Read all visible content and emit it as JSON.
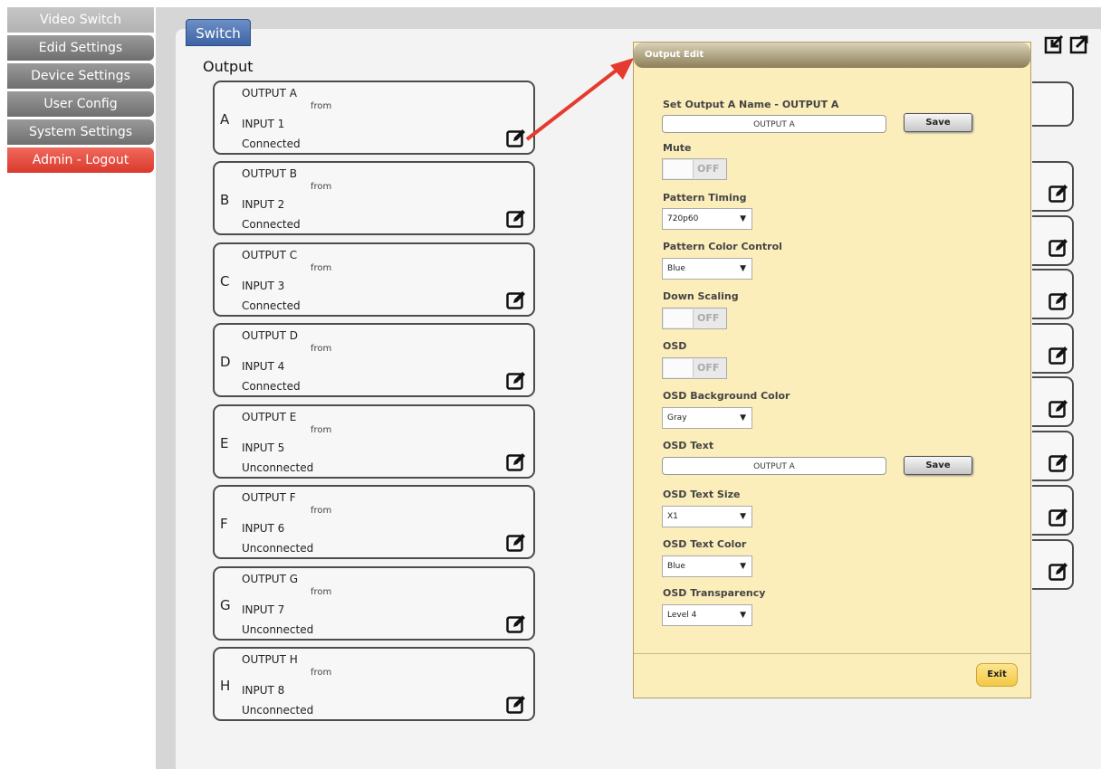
{
  "sidebar": {
    "items": [
      {
        "label": "Video Switch"
      },
      {
        "label": "Edid Settings"
      },
      {
        "label": "Device Settings"
      },
      {
        "label": "User Config"
      },
      {
        "label": "System Settings"
      },
      {
        "label": "Admin - Logout"
      }
    ]
  },
  "tab": {
    "label": "Switch"
  },
  "section_title": "Output",
  "outputs": [
    {
      "letter": "A",
      "name": "OUTPUT A",
      "from": "from",
      "input": "INPUT 1",
      "status": "Connected"
    },
    {
      "letter": "B",
      "name": "OUTPUT B",
      "from": "from",
      "input": "INPUT 2",
      "status": "Connected"
    },
    {
      "letter": "C",
      "name": "OUTPUT C",
      "from": "from",
      "input": "INPUT 3",
      "status": "Connected"
    },
    {
      "letter": "D",
      "name": "OUTPUT D",
      "from": "from",
      "input": "INPUT 4",
      "status": "Connected"
    },
    {
      "letter": "E",
      "name": "OUTPUT E",
      "from": "from",
      "input": "INPUT 5",
      "status": "Unconnected"
    },
    {
      "letter": "F",
      "name": "OUTPUT F",
      "from": "from",
      "input": "INPUT 6",
      "status": "Unconnected"
    },
    {
      "letter": "G",
      "name": "OUTPUT G",
      "from": "from",
      "input": "INPUT 7",
      "status": "Unconnected"
    },
    {
      "letter": "H",
      "name": "OUTPUT H",
      "from": "from",
      "input": "INPUT 8",
      "status": "Unconnected"
    }
  ],
  "modal": {
    "title": "Output Edit",
    "name_label": "Set Output A Name - OUTPUT A",
    "name_value": "OUTPUT A",
    "save_label": "Save",
    "mute_label": "Mute",
    "mute_state": "OFF",
    "pattern_timing_label": "Pattern Timing",
    "pattern_timing_value": "720p60",
    "pattern_color_label": "Pattern Color Control",
    "pattern_color_value": "Blue",
    "downscaling_label": "Down Scaling",
    "downscaling_state": "OFF",
    "osd_label": "OSD",
    "osd_state": "OFF",
    "osd_bg_label": "OSD Background Color",
    "osd_bg_value": "Gray",
    "osd_text_label": "OSD Text",
    "osd_text_value": "OUTPUT A",
    "osd_save_label": "Save",
    "osd_text_size_label": "OSD Text Size",
    "osd_text_size_value": "X1",
    "osd_text_color_label": "OSD Text Color",
    "osd_text_color_value": "Blue",
    "osd_transparency_label": "OSD Transparency",
    "osd_transparency_value": "Level 4",
    "exit_label": "Exit"
  },
  "colors": {
    "accent_blue": "#3d64a4",
    "logout_red": "#d9392c",
    "modal_bg": "#fbeebb",
    "arrow_red": "#e53a2d"
  },
  "icons": {
    "edit": "edit-icon",
    "import": "import-icon",
    "export": "export-icon"
  }
}
